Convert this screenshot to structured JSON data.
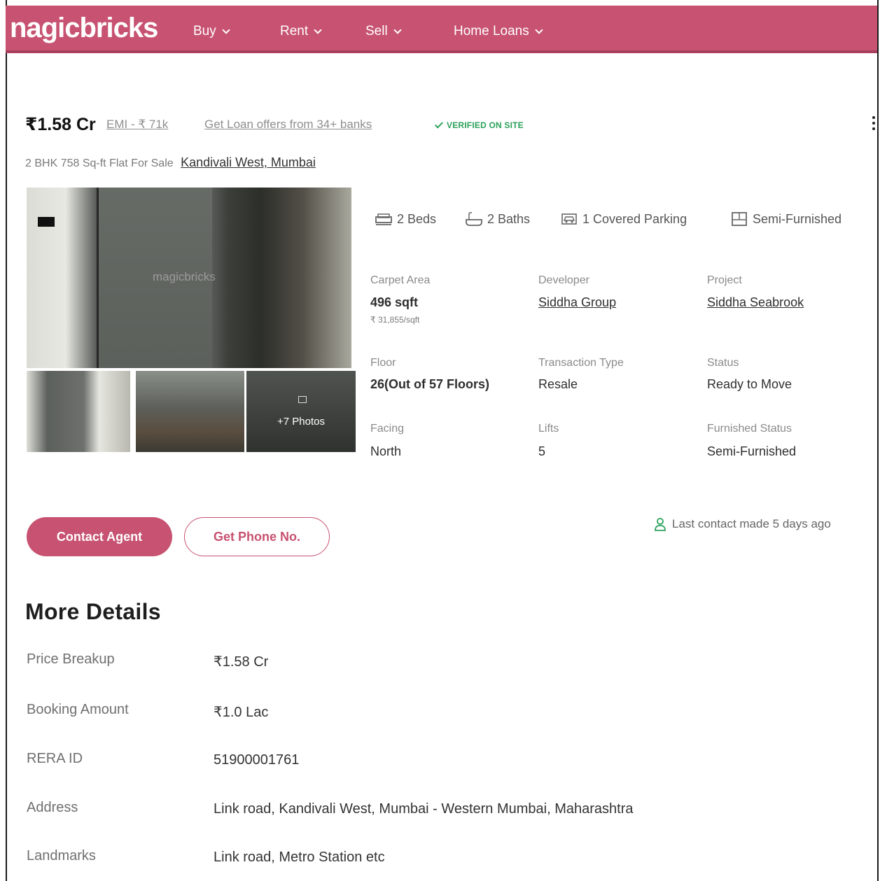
{
  "header": {
    "logo": "nagicbricks",
    "nav": [
      {
        "label": "Buy"
      },
      {
        "label": "Rent"
      },
      {
        "label": "Sell"
      },
      {
        "label": "Home Loans"
      }
    ]
  },
  "listing": {
    "price": "₹1.58 Cr",
    "emi": "EMI - ₹ 71k",
    "loan_offers": "Get Loan offers from 34+ banks",
    "verified": "VERIFIED ON SITE",
    "title": "2 BHK 758 Sq-ft Flat For Sale",
    "location": "Kandivali West, Mumbai",
    "photo_watermark": "magicbricks",
    "more_photos": "+7 Photos",
    "amenities": [
      {
        "label": "2 Beds",
        "icon": "bed-icon"
      },
      {
        "label": "2 Baths",
        "icon": "bath-icon"
      },
      {
        "label": "1 Covered Parking",
        "icon": "car-icon"
      },
      {
        "label": "Semi-Furnished",
        "icon": "furniture-icon"
      }
    ],
    "facts": {
      "carpet_area_label": "Carpet Area",
      "carpet_area_value": "496 sqft",
      "carpet_area_rate": "₹ 31,855/sqft",
      "developer_label": "Developer",
      "developer_value": "Siddha Group",
      "project_label": "Project",
      "project_value": "Siddha Seabrook",
      "floor_label": "Floor",
      "floor_value": "26(Out of 57 Floors)",
      "transaction_label": "Transaction Type",
      "transaction_value": "Resale",
      "status_label": "Status",
      "status_value": "Ready to Move",
      "facing_label": "Facing",
      "facing_value": "North",
      "lifts_label": "Lifts",
      "lifts_value": "5",
      "furnished_label": "Furnished Status",
      "furnished_value": "Semi-Furnished"
    },
    "actions": {
      "contact_agent": "Contact Agent",
      "get_phone": "Get Phone No."
    },
    "last_contact": "Last contact made 5 days ago"
  },
  "more_details": {
    "heading": "More Details",
    "rows": [
      {
        "label": "Price Breakup",
        "value": "₹1.58 Cr"
      },
      {
        "label": "Booking Amount",
        "value": "₹1.0 Lac"
      },
      {
        "label": "RERA ID",
        "value": "51900001761"
      },
      {
        "label": "Address",
        "value": "Link road, Kandivali West, Mumbai - Western Mumbai, Maharashtra"
      },
      {
        "label": "Landmarks",
        "value": "Link road, Metro Station etc"
      }
    ]
  },
  "colors": {
    "brand": "#c75271",
    "verified": "#2aa15a"
  }
}
